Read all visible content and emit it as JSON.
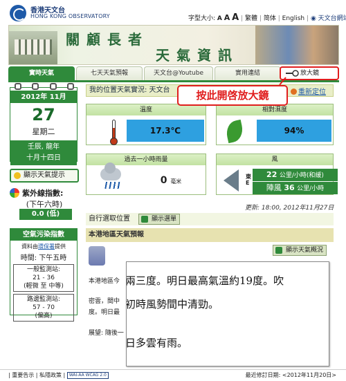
{
  "header": {
    "org_zh": "香港天文台",
    "org_en": "HONG KONG OBSERVATORY",
    "font_size_label": "字型大小:",
    "font_a": [
      "A",
      "A",
      "A"
    ],
    "lang_trad": "繁體",
    "lang_simp": "简体",
    "lang_en": "English",
    "hko_site": "天文台網站"
  },
  "banner": {
    "line1": "關顧長者",
    "line2": "天氣資訊"
  },
  "tabs": [
    {
      "label": "實時天氣"
    },
    {
      "label": "七天天氣預報"
    },
    {
      "label": "天文台@Youtube"
    },
    {
      "label": "實用連結"
    }
  ],
  "magnifier": {
    "label": "放大鏡",
    "icon": "magnifier-icon"
  },
  "callout": {
    "text": "按此開啓放大鏡"
  },
  "calendar": {
    "year_month": "2012年  11月",
    "day": "27",
    "weekday": "星期二",
    "lunar_year": "壬辰, 龍年",
    "lunar_date": "十月十四日"
  },
  "tips_button": {
    "label": "顯示天氣提示"
  },
  "uv": {
    "title": "紫外線指數:",
    "time": "(下午六時)",
    "value": "0.0 (低)"
  },
  "air_quality": {
    "title": "空氣污染指數",
    "source_prefix": "資料由",
    "source_link": "環保署",
    "source_suffix": "提供",
    "time": "時間: 下午五時",
    "general": {
      "label": "一般監測站:",
      "value": "21 - 36",
      "level": "(輕微 至 中等)"
    },
    "roadside": {
      "label": "路邊監測站:",
      "value": "57 - 70",
      "level": "(偏高)"
    }
  },
  "location_bar": {
    "text": "我的位置天氣實況: 天文台",
    "relocate": "重新定位"
  },
  "temperature": {
    "title": "溫度",
    "value": "17.3℃"
  },
  "humidity": {
    "title": "相對濕度",
    "value": "94%"
  },
  "rainfall": {
    "title": "過去一小時雨量",
    "value": "0",
    "unit": "毫米"
  },
  "wind": {
    "title": "風",
    "dir_label_top": "東",
    "dir_label_bottom": "E",
    "speed_value": "22",
    "speed_unit": "公里/小時",
    "speed_desc": "(和緩)",
    "gust_label": "陣風",
    "gust_value": "36",
    "gust_unit": "公里/小時"
  },
  "updated": "更新: 18:00, 2012年11月27日",
  "location_select": {
    "label": "自行選取位置",
    "map_button": "顯示選單"
  },
  "forecast": {
    "title": "本港地區天氣預報",
    "overview_button": "顯示天氣概況",
    "line1": "本港地區今",
    "line2": "密雲，間中",
    "line3": "度。明日最",
    "line4": "展望: 隨後一"
  },
  "magnifier_view": {
    "line1": "兩三度。明日最高氣溫約19度。吹",
    "line2": "初時風勢間中清勁。",
    "line3": "日多雲有雨。"
  },
  "footer": {
    "notices": "| 重要告示 | 私隱政策 |",
    "wai": "WAI-AA WCAG 2.0",
    "revised": "最近修訂日期: <2012年11月20日>"
  }
}
